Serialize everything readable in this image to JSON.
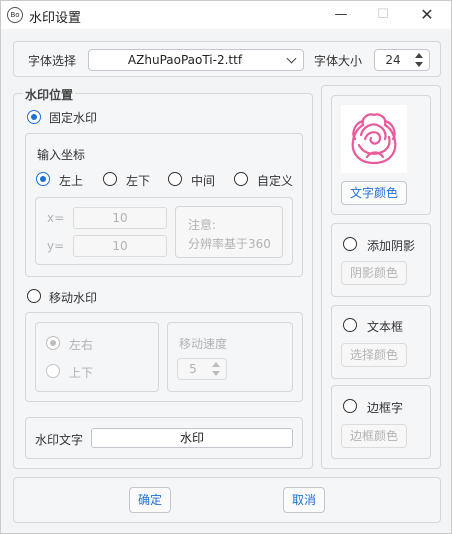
{
  "window": {
    "title": "水印设置",
    "app_icon": "Bo",
    "min_icon": "—",
    "max_icon": "☐",
    "close_icon": "✕"
  },
  "font_row": {
    "font_label": "字体选择",
    "font_value": "AZhuPaoPaoTi-2.ttf",
    "size_label": "字体大小",
    "size_value": "24"
  },
  "position": {
    "group_title": "水印位置",
    "fixed_label": "固定水印",
    "coord_title": "输入坐标",
    "options": [
      "左上",
      "左下",
      "中间",
      "自定义"
    ],
    "x_label": "x=",
    "x_value": "10",
    "y_label": "y=",
    "y_value": "10",
    "note_line1": "注意:",
    "note_line2": "分辨率基于360",
    "moving_label": "移动水印",
    "dir_options": [
      "左右",
      "上下"
    ],
    "speed_label": "移动速度",
    "speed_value": "5",
    "text_label": "水印文字",
    "text_value": "水印"
  },
  "right": {
    "text_color_btn": "文字颜色",
    "shadow_label": "添加阴影",
    "shadow_color_btn": "阴影颜色",
    "textbox_label": "文本框",
    "select_color_btn": "选择颜色",
    "border_label": "边框字",
    "border_color_btn": "边框颜色",
    "swatch_color": "#e85a9a",
    "swatch_icon": "rose-icon"
  },
  "footer": {
    "ok": "确定",
    "cancel": "取消"
  }
}
